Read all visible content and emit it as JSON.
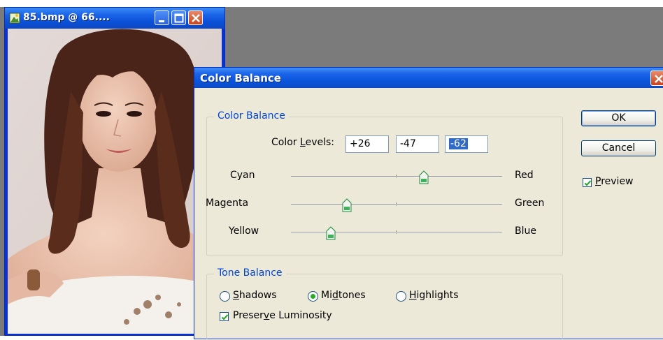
{
  "document_window": {
    "title": "85.bmp @ 66...."
  },
  "dialog": {
    "title": "Color Balance",
    "color_balance_group": {
      "legend": "Color Balance",
      "levels_label_pre": "Color ",
      "levels_label_accel": "L",
      "levels_label_post": "evels:",
      "levels": [
        "+26",
        "-47",
        "-62"
      ],
      "sliders": [
        {
          "left": "Cyan",
          "right": "Red",
          "value": 26
        },
        {
          "left": "Magenta",
          "right": "Green",
          "value": -47
        },
        {
          "left": "Yellow",
          "right": "Blue",
          "value": -62
        }
      ]
    },
    "tone_balance_group": {
      "legend": "Tone Balance",
      "radios": [
        {
          "accel": "S",
          "rest": "hadows",
          "pre": "",
          "selected": false
        },
        {
          "pre": "Mi",
          "accel": "d",
          "rest": "tones",
          "selected": true
        },
        {
          "pre": "",
          "accel": "H",
          "rest": "ighlights",
          "selected": false
        }
      ],
      "preserve_pre": "Preser",
      "preserve_accel": "v",
      "preserve_post": "e Luminosity",
      "preserve_checked": true
    },
    "buttons": {
      "ok": "OK",
      "cancel": "Cancel"
    },
    "preview": {
      "accel": "P",
      "rest": "review",
      "checked": true
    }
  },
  "colors": {
    "accent_title": "#0a55dc",
    "group_legend": "#0046d5",
    "dialog_bg": "#ece9d8",
    "workspace": "#7b7b7b"
  }
}
